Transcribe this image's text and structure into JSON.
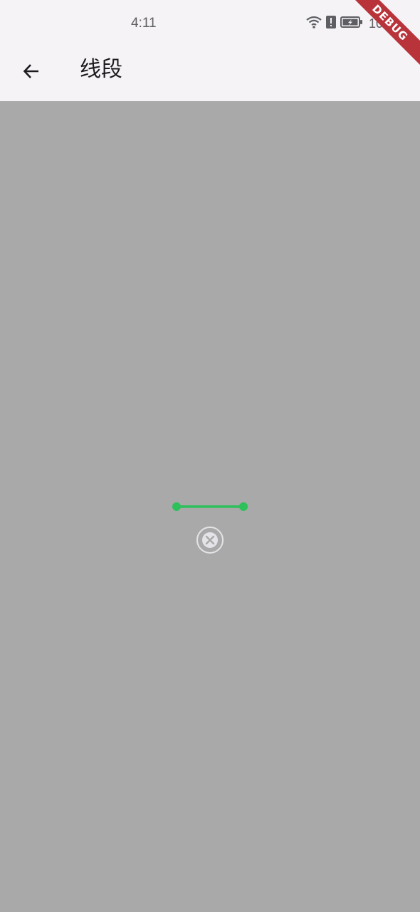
{
  "status_bar": {
    "time": "4:11",
    "battery_text": "100",
    "icons": [
      "wifi-icon",
      "alert-icon",
      "battery-icon"
    ]
  },
  "app_bar": {
    "title": "线段",
    "back_icon": "arrow-left-icon"
  },
  "debug_banner": "DEBUG",
  "canvas": {
    "background": "#a9a9a9",
    "line_color": "#2ec05a",
    "close_icon": "close-circle-icon"
  }
}
